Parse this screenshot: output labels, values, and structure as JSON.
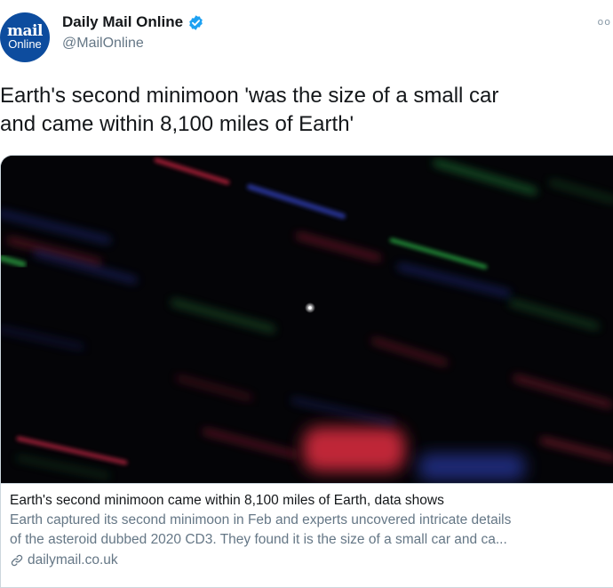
{
  "author": {
    "avatar_top": "mail",
    "avatar_bottom": "Online",
    "name": "Daily Mail Online",
    "handle": "@MailOnline",
    "verified": true,
    "avatar_color": "#0d4c9e",
    "verified_color": "#1da1f2"
  },
  "menu": {
    "icon": "more-icon",
    "glyph": "oo"
  },
  "tweet": {
    "line1": "Earth's second minimoon 'was the size of a small car",
    "line2": "and came within 8,100 miles of Earth'"
  },
  "card": {
    "image_description_icon": "image",
    "title": "Earth's second minimoon came within 8,100 miles of Earth, data shows",
    "desc_line1": "Earth captured its second minimoon in Feb and experts uncovered intricate details",
    "desc_line2": "of the asteroid dubbed 2020 CD3. They found it is the size of a small car and ca...",
    "domain": "dailymail.co.uk",
    "domain_icon": "link-icon"
  },
  "colors": {
    "text_primary": "#14171a",
    "text_secondary": "#657786",
    "border": "#ccd6dd"
  }
}
